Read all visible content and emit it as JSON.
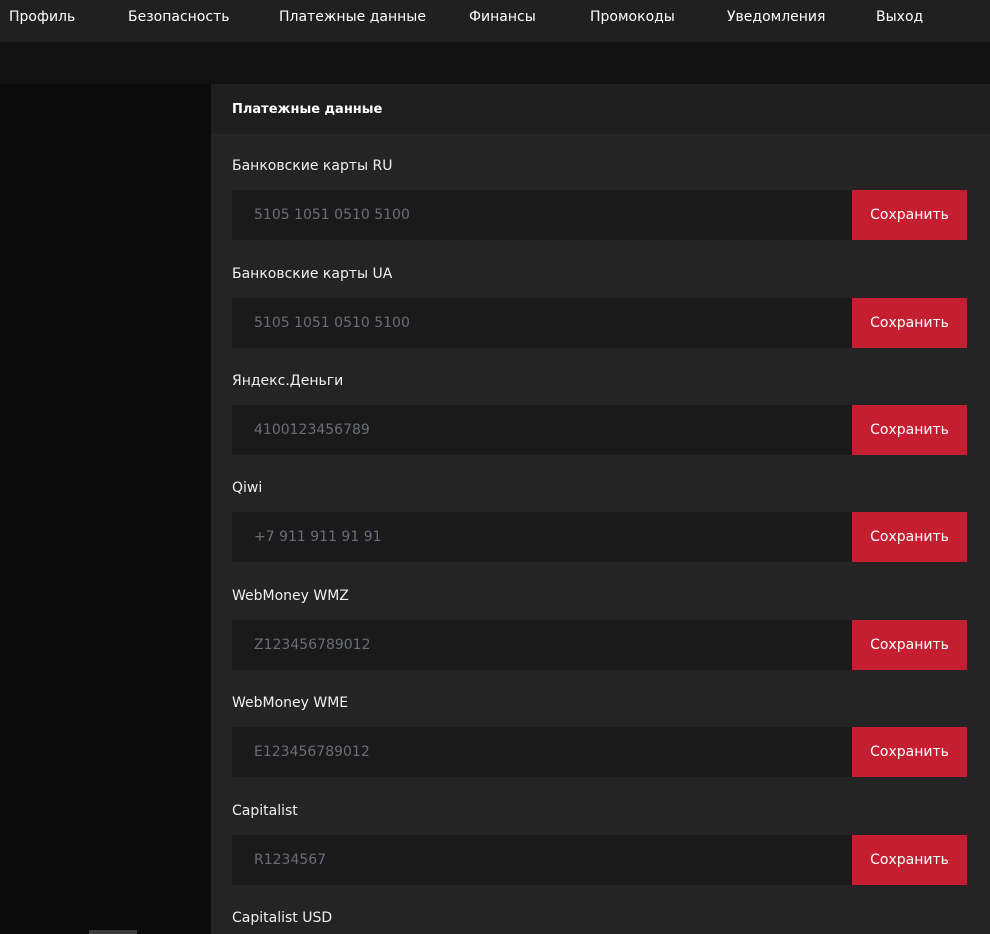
{
  "nav": {
    "items": [
      {
        "label": "Профиль"
      },
      {
        "label": "Безопасность"
      },
      {
        "label": "Платежные данные"
      },
      {
        "label": "Финансы"
      },
      {
        "label": "Промокоды"
      },
      {
        "label": "Уведомления"
      },
      {
        "label": "Выход"
      }
    ]
  },
  "panel": {
    "title": "Платежные данные",
    "save_label": "Сохранить",
    "fields": [
      {
        "label": "Банковские карты RU",
        "placeholder": "5105 1051 0510 5100"
      },
      {
        "label": "Банковские карты UA",
        "placeholder": "5105 1051 0510 5100"
      },
      {
        "label": "Яндекс.Деньги",
        "placeholder": "4100123456789"
      },
      {
        "label": "Qiwi",
        "placeholder": "+7 911 911 91 91"
      },
      {
        "label": "WebMoney WMZ",
        "placeholder": "Z123456789012"
      },
      {
        "label": "WebMoney WME",
        "placeholder": "E123456789012"
      },
      {
        "label": "Capitalist",
        "placeholder": "R1234567"
      },
      {
        "label": "Capitalist USD",
        "placeholder": ""
      }
    ]
  },
  "colors": {
    "accent": "#c41e30",
    "background": "#0d0d0d",
    "panel": "#242424",
    "input": "#1a1a1b"
  }
}
